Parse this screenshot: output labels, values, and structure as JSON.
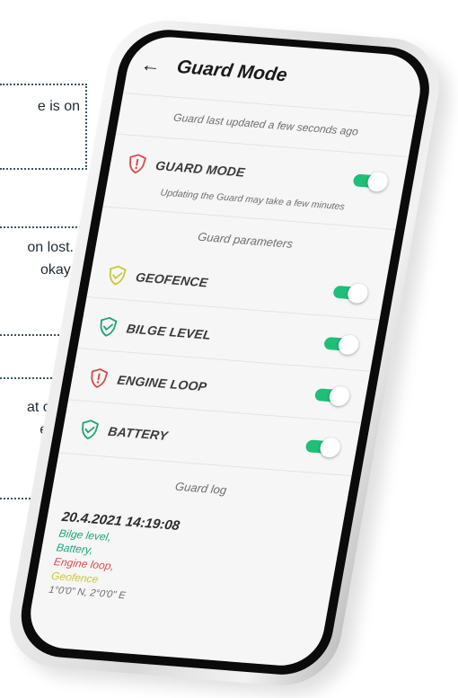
{
  "notes": [
    [
      "e is on",
      ""
    ],
    [
      "on lost.",
      "okay."
    ],
    [
      "at or",
      "er."
    ]
  ],
  "screen": {
    "title": "Guard Mode",
    "last_updated": "Guard last updated a few seconds ago",
    "guard_mode": {
      "label": "GUARD MODE",
      "enabled": true
    },
    "guard_note": "Updating the Guard may take a few minutes",
    "params_heading": "Guard parameters",
    "params": [
      {
        "label": "GEOFENCE",
        "status_color": "#c8c83a",
        "icon": "shield-check-icon",
        "enabled": true
      },
      {
        "label": "BILGE LEVEL",
        "status_color": "#1fa47a",
        "icon": "shield-check-icon",
        "enabled": true
      },
      {
        "label": "ENGINE LOOP",
        "status_color": "#d94c4c",
        "icon": "shield-alert-icon",
        "enabled": true
      },
      {
        "label": "BATTERY",
        "status_color": "#1fa47a",
        "icon": "shield-check-icon",
        "enabled": true
      }
    ],
    "log_heading": "Guard log",
    "log": {
      "timestamp": "20.4.2021 14:19:08",
      "entries": [
        {
          "text": "Bilge level,",
          "color": "#1fa47a"
        },
        {
          "text": "Battery,",
          "color": "#1fa47a"
        },
        {
          "text": "Engine loop,",
          "color": "#d94c4c"
        },
        {
          "text": "Geofence",
          "color": "#c8c83a"
        }
      ],
      "coords": "1°0'0\" N, 2°0'0\" E"
    }
  },
  "colors": {
    "toggle_on": "#1fbf78",
    "alert": "#d94c4c",
    "ok": "#1fa47a",
    "warn": "#c8c83a"
  }
}
